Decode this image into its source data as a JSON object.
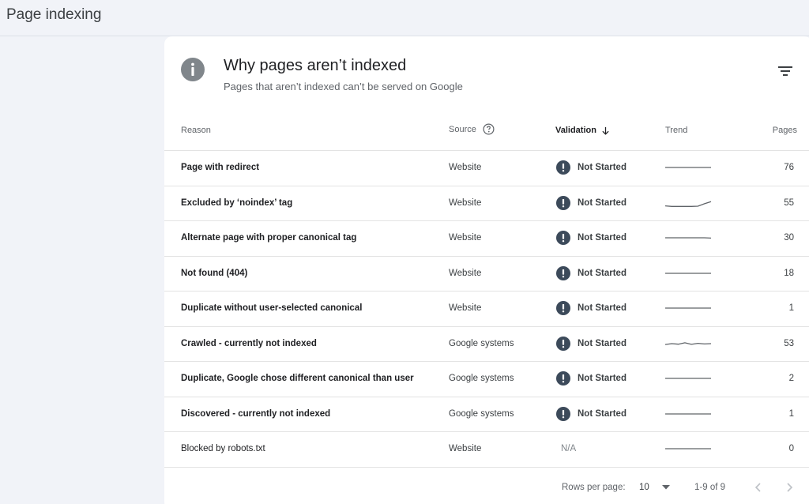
{
  "page": {
    "title": "Page indexing"
  },
  "card": {
    "title": "Why pages aren’t indexed",
    "subtitle": "Pages that aren’t indexed can’t be served on Google"
  },
  "table": {
    "headers": {
      "reason": "Reason",
      "source": "Source",
      "validation": "Validation",
      "trend": "Trend",
      "pages": "Pages"
    },
    "rows": [
      {
        "reason": "Page with redirect",
        "source": "Website",
        "validation": "Not Started",
        "pages": "76",
        "trend": [
          5,
          5,
          5,
          5,
          5,
          5,
          5,
          5
        ]
      },
      {
        "reason": "Excluded by ‘noindex’ tag",
        "source": "Website",
        "validation": "Not Started",
        "pages": "55",
        "trend": [
          3,
          2.6,
          2.6,
          2.6,
          2.6,
          2.8,
          4.5,
          6
        ]
      },
      {
        "reason": "Alternate page with proper canonical tag",
        "source": "Website",
        "validation": "Not Started",
        "pages": "30",
        "trend": [
          5,
          5,
          5,
          5,
          5,
          5,
          5,
          4.8
        ]
      },
      {
        "reason": "Not found (404)",
        "source": "Website",
        "validation": "Not Started",
        "pages": "18",
        "trend": [
          5,
          5,
          5,
          5,
          5,
          5,
          5,
          5
        ]
      },
      {
        "reason": "Duplicate without user-selected canonical",
        "source": "Website",
        "validation": "Not Started",
        "pages": "1",
        "trend": [
          5,
          5,
          5,
          5,
          5,
          5,
          5,
          5
        ]
      },
      {
        "reason": "Crawled - currently not indexed",
        "source": "Google systems",
        "validation": "Not Started",
        "pages": "53",
        "trend": [
          4.4,
          5,
          4.6,
          5.6,
          4.5,
          5.2,
          4.8,
          5
        ]
      },
      {
        "reason": "Duplicate, Google chose different canonical than user",
        "source": "Google systems",
        "validation": "Not Started",
        "pages": "2",
        "trend": [
          5,
          5,
          5,
          5,
          5,
          5,
          5,
          5
        ]
      },
      {
        "reason": "Discovered - currently not indexed",
        "source": "Google systems",
        "validation": "Not Started",
        "pages": "1",
        "trend": [
          5,
          5,
          5,
          5,
          5,
          5,
          5,
          5
        ]
      },
      {
        "reason": "Blocked by robots.txt",
        "source": "Website",
        "validation": "N/A",
        "pages": "0",
        "trend": [
          5,
          5,
          5,
          5,
          5,
          5,
          5,
          5
        ],
        "plain": true
      }
    ]
  },
  "footer": {
    "rows_per_page_label": "Rows per page:",
    "rows_per_page_value": "10",
    "range": "1-9 of 9"
  },
  "colors": {
    "icon_gray": "#80868b",
    "status_icon": "#3c4a5a",
    "divider": "#e3e3e3",
    "trend_line": "#5f6368"
  }
}
